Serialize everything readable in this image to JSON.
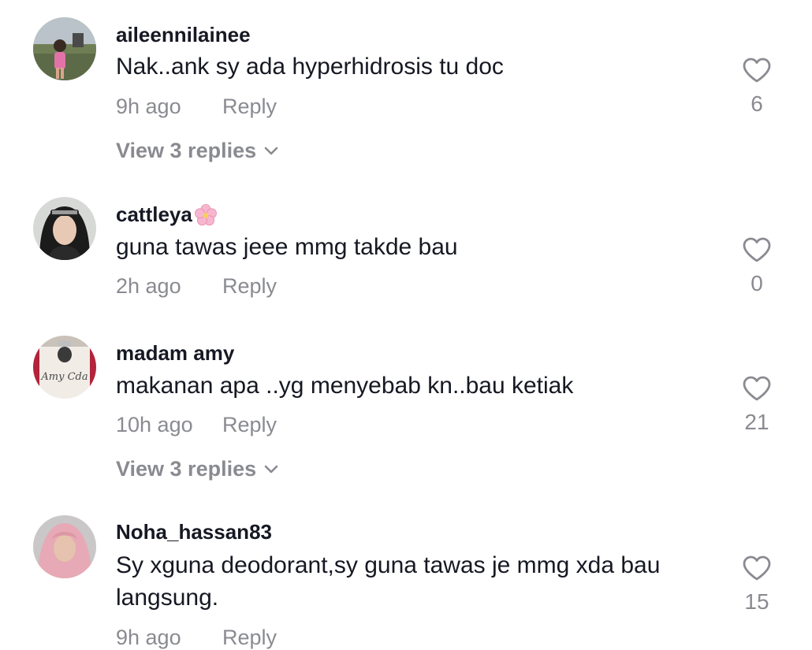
{
  "comments": [
    {
      "username": "aileennilainee",
      "text": "Nak..ank sy ada hyperhidrosis tu doc",
      "time": "9h ago",
      "reply_label": "Reply",
      "likes": "6",
      "view_replies": "View 3 replies"
    },
    {
      "username": "cattleya",
      "text": "guna tawas jeee mmg takde bau",
      "time": "2h ago",
      "reply_label": "Reply",
      "likes": "0"
    },
    {
      "username": "madam amy",
      "avatar_text": "Amy Cda",
      "text": "makanan apa ..yg menyebab kn..bau ketiak",
      "time": "10h ago",
      "reply_label": "Reply",
      "likes": "21",
      "view_replies": "View 3 replies"
    },
    {
      "username": "Noha_hassan83",
      "text": "Sy xguna deodorant,sy guna tawas je mmg xda bau langsung.",
      "time": "9h ago",
      "reply_label": "Reply",
      "likes": "15"
    }
  ],
  "icons": {
    "like": "heart-outline-icon",
    "expand": "chevron-down-icon",
    "emoji": "cherry-blossom-icon"
  },
  "colors": {
    "primary_text": "#161823",
    "secondary_text": "#8a8b91",
    "background": "#ffffff"
  }
}
